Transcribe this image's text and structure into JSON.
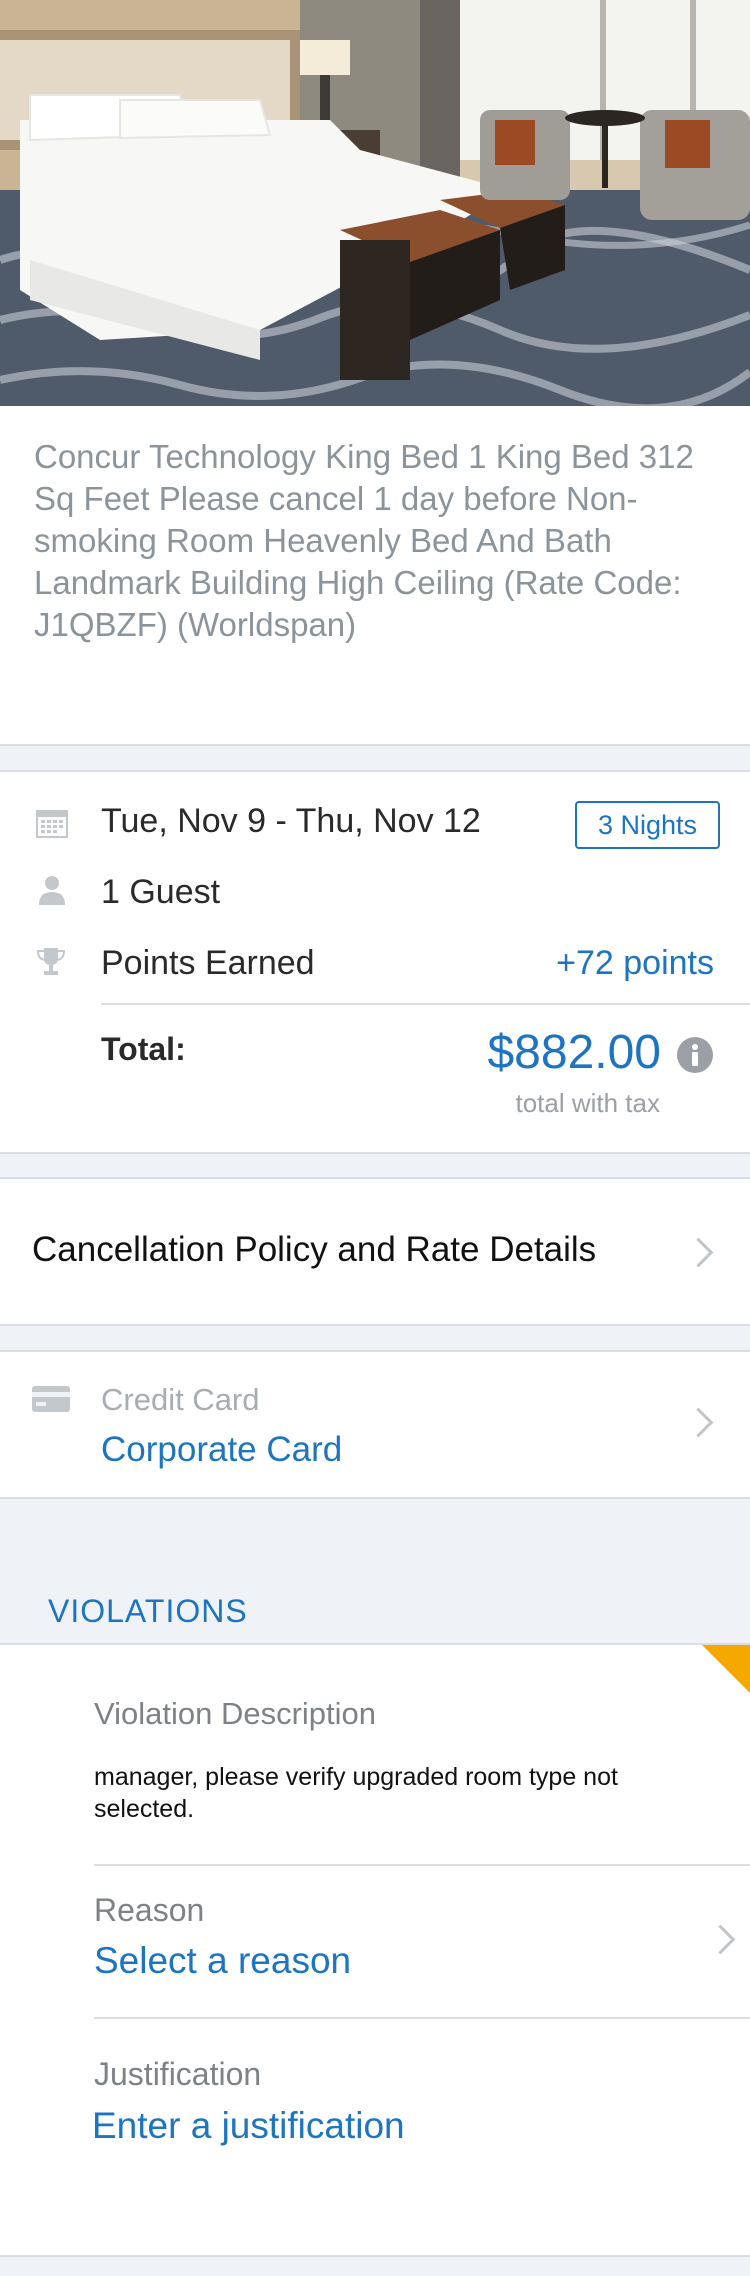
{
  "hotel": {
    "room_description": "Concur Technology King Bed 1 King Bed 312 Sq Feet Please cancel 1 day before Non-smoking Room Heavenly Bed And Bath Landmark Building High Ceiling (Rate Code: J1QBZF)  (Worldspan)"
  },
  "stay": {
    "dates": "Tue, Nov 9 - Thu, Nov 12",
    "nights": "3 Nights",
    "guests": "1 Guest",
    "points_label": "Points Earned",
    "points_value": "+72 points",
    "total_label": "Total:",
    "total_value": "$882.00",
    "total_note": "total with tax"
  },
  "cancellation": {
    "label": "Cancellation Policy and Rate Details"
  },
  "payment": {
    "label": "Credit Card",
    "value": "Corporate Card"
  },
  "violations": {
    "header": "VIOLATIONS",
    "description_label": "Violation Description",
    "description_text": "manager, please verify upgraded room type not selected.",
    "reason_label": "Reason",
    "reason_value": "Select a reason",
    "justification_label": "Justification",
    "justification_value": "Enter a justification"
  },
  "colors": {
    "accent": "#1d74c0",
    "warning": "#f5a800"
  },
  "icons": [
    "calendar-icon",
    "person-icon",
    "trophy-icon",
    "info-icon",
    "credit-card-icon",
    "chevron-right-icon"
  ]
}
